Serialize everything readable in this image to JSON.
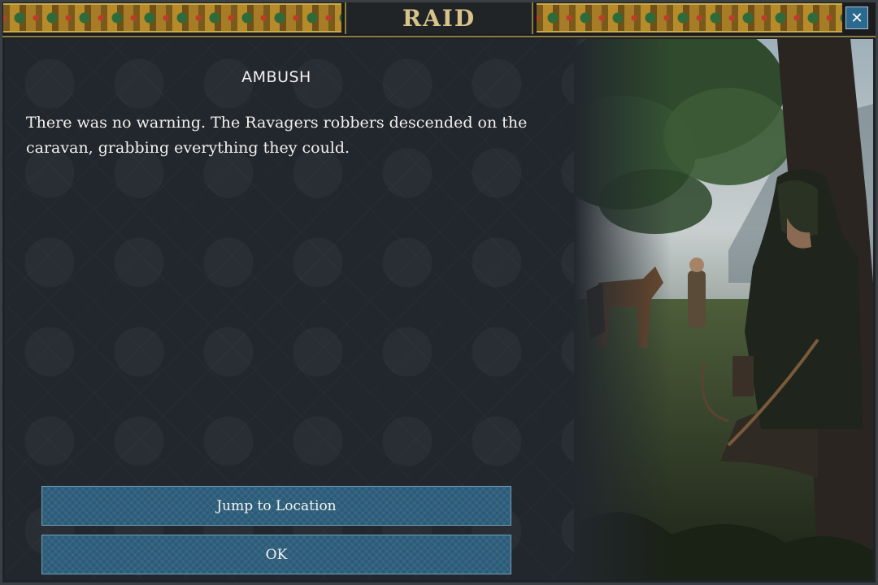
{
  "window": {
    "title": "RAID",
    "close_label": "✕"
  },
  "event": {
    "heading": "AMBUSH",
    "description": "There was no warning. The Ravagers robbers descended on the caravan, grabbing everything they could."
  },
  "buttons": {
    "jump_label": "Jump to Location",
    "ok_label": "OK"
  },
  "colors": {
    "button": "#2a5b78",
    "title_gold": "#d8c48a",
    "close_button": "#2b6a8e"
  },
  "illustration": {
    "subject": "hooded archer beside tree watching a horse-drawn caravan"
  }
}
